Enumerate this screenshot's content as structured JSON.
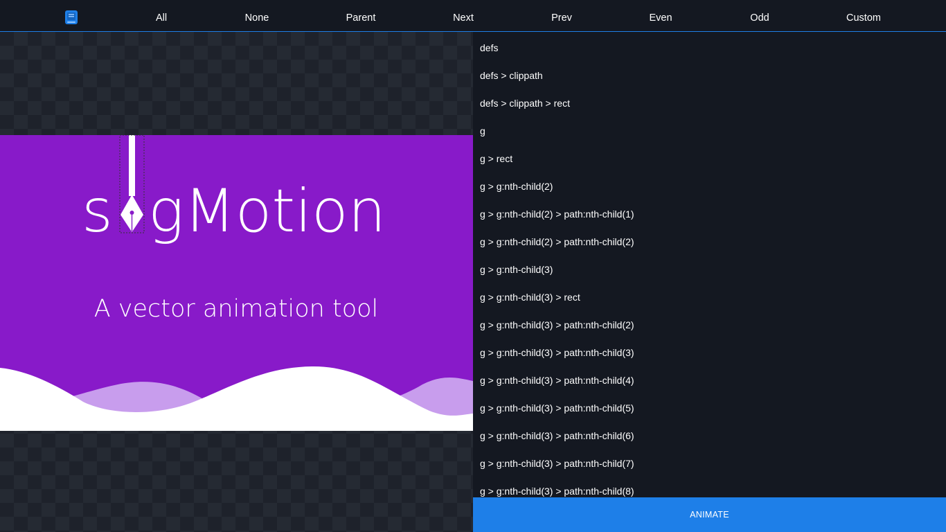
{
  "nav": {
    "items": [
      {
        "label": "All"
      },
      {
        "label": "None"
      },
      {
        "label": "Parent"
      },
      {
        "label": "Next"
      },
      {
        "label": "Prev"
      },
      {
        "label": "Even"
      },
      {
        "label": "Odd"
      },
      {
        "label": "Custom"
      }
    ]
  },
  "artwork": {
    "logo_text_left": "s",
    "logo_text_right": "gMotion",
    "tagline": "A vector animation tool",
    "colors": {
      "purple": "#881ac9",
      "light_purple": "#c89ded",
      "white": "#ffffff"
    }
  },
  "selectors": {
    "items": [
      "defs",
      "defs > clippath",
      "defs > clippath > rect",
      "g",
      "g > rect",
      "g > g:nth-child(2)",
      "g > g:nth-child(2) > path:nth-child(1)",
      "g > g:nth-child(2) > path:nth-child(2)",
      "g > g:nth-child(3)",
      "g > g:nth-child(3) > rect",
      "g > g:nth-child(3) > path:nth-child(2)",
      "g > g:nth-child(3) > path:nth-child(3)",
      "g > g:nth-child(3) > path:nth-child(4)",
      "g > g:nth-child(3) > path:nth-child(5)",
      "g > g:nth-child(3) > path:nth-child(6)",
      "g > g:nth-child(3) > path:nth-child(7)",
      "g > g:nth-child(3) > path:nth-child(8)"
    ]
  },
  "animate_button": {
    "label": "ANIMATE"
  },
  "theme": {
    "background": "#141821",
    "accent": "#1e7fe8"
  }
}
